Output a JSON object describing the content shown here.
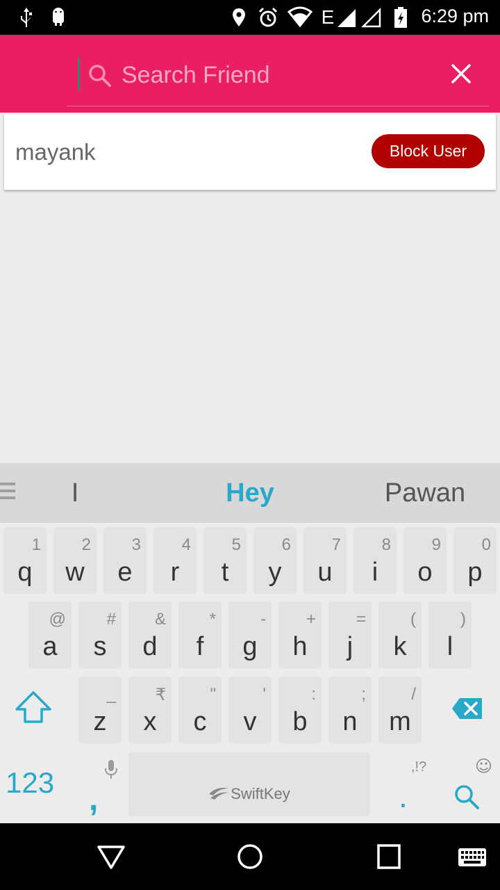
{
  "status_bar": {
    "time": "6:29 pm",
    "network_label": "E"
  },
  "search": {
    "placeholder": "Search Friend",
    "value": ""
  },
  "results": [
    {
      "name": "mayank",
      "action_label": "Block User"
    }
  ],
  "keyboard": {
    "suggestions": [
      "I",
      "Hey",
      "Pawan"
    ],
    "row1": [
      {
        "l": "q",
        "h": "1"
      },
      {
        "l": "w",
        "h": "2"
      },
      {
        "l": "e",
        "h": "3"
      },
      {
        "l": "r",
        "h": "4"
      },
      {
        "l": "t",
        "h": "5"
      },
      {
        "l": "y",
        "h": "6"
      },
      {
        "l": "u",
        "h": "7"
      },
      {
        "l": "i",
        "h": "8"
      },
      {
        "l": "o",
        "h": "9"
      },
      {
        "l": "p",
        "h": "0"
      }
    ],
    "row2": [
      {
        "l": "a",
        "h": "@"
      },
      {
        "l": "s",
        "h": "#"
      },
      {
        "l": "d",
        "h": "&"
      },
      {
        "l": "f",
        "h": "*"
      },
      {
        "l": "g",
        "h": "-"
      },
      {
        "l": "h",
        "h": "+"
      },
      {
        "l": "j",
        "h": "="
      },
      {
        "l": "k",
        "h": "("
      },
      {
        "l": "l",
        "h": ")"
      }
    ],
    "row3": [
      {
        "l": "z",
        "h": "_"
      },
      {
        "l": "x",
        "h": "₹"
      },
      {
        "l": "c",
        "h": "\""
      },
      {
        "l": "v",
        "h": "'"
      },
      {
        "l": "b",
        "h": ":"
      },
      {
        "l": "n",
        "h": ";"
      },
      {
        "l": "m",
        "h": "/"
      }
    ],
    "num_label": "123",
    "comma": ",",
    "space_brand": "SwiftKey",
    "dot": ".",
    "dot_hint": ",!?"
  },
  "colors": {
    "header": "#e91e63",
    "block_button": "#b00000",
    "accent": "#29a9c8"
  }
}
